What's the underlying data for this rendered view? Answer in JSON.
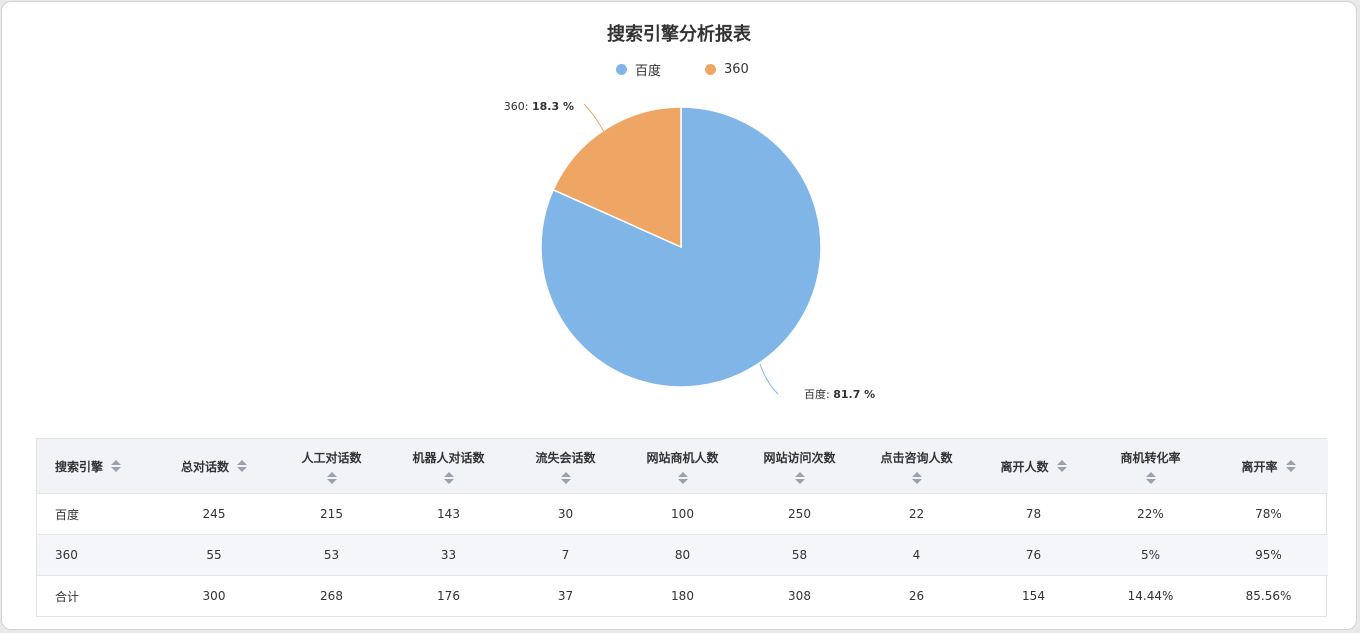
{
  "colors": {
    "baidu": "#80b5e8",
    "s360": "#efa664"
  },
  "chart_data": {
    "type": "pie",
    "title": "搜索引擎分析报表",
    "legend_placement": "top",
    "slices": [
      {
        "name": "百度",
        "value": 81.7,
        "label": "百度",
        "pct_text": "81.7 %",
        "color": "#80b5e8"
      },
      {
        "name": "360",
        "value": 18.3,
        "label": "360",
        "pct_text": "18.3 %",
        "color": "#efa664"
      }
    ]
  },
  "table": {
    "headers": [
      "搜索引擎",
      "总对话数",
      "人工对话数",
      "机器人对话数",
      "流失会话数",
      "网站商机人数",
      "网站访问次数",
      "点击咨询人数",
      "离开人数",
      "商机转化率",
      "离开率"
    ],
    "rows": [
      [
        "百度",
        "245",
        "215",
        "143",
        "30",
        "100",
        "250",
        "22",
        "78",
        "22%",
        "78%"
      ],
      [
        "360",
        "55",
        "53",
        "33",
        "7",
        "80",
        "58",
        "4",
        "76",
        "5%",
        "95%"
      ],
      [
        "合计",
        "300",
        "268",
        "176",
        "37",
        "180",
        "308",
        "26",
        "154",
        "14.44%",
        "85.56%"
      ]
    ]
  }
}
